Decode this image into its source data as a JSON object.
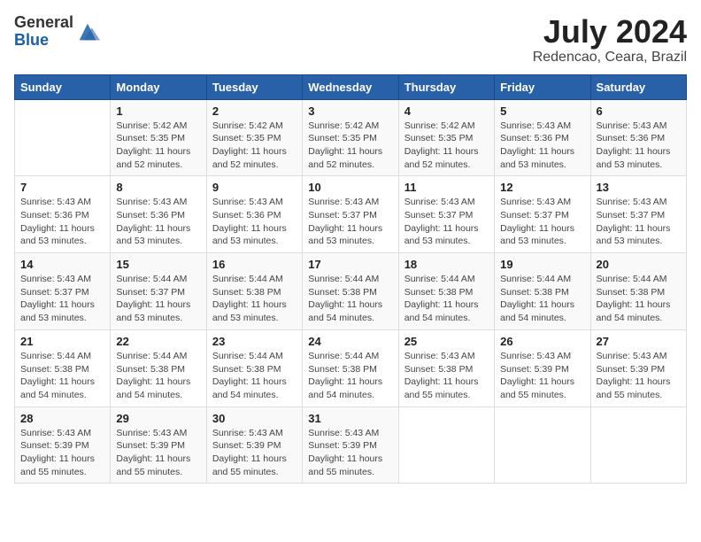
{
  "logo": {
    "general": "General",
    "blue": "Blue"
  },
  "title": "July 2024",
  "location": "Redencao, Ceara, Brazil",
  "days_of_week": [
    "Sunday",
    "Monday",
    "Tuesday",
    "Wednesday",
    "Thursday",
    "Friday",
    "Saturday"
  ],
  "weeks": [
    [
      {
        "num": "",
        "info": ""
      },
      {
        "num": "1",
        "info": "Sunrise: 5:42 AM\nSunset: 5:35 PM\nDaylight: 11 hours\nand 52 minutes."
      },
      {
        "num": "2",
        "info": "Sunrise: 5:42 AM\nSunset: 5:35 PM\nDaylight: 11 hours\nand 52 minutes."
      },
      {
        "num": "3",
        "info": "Sunrise: 5:42 AM\nSunset: 5:35 PM\nDaylight: 11 hours\nand 52 minutes."
      },
      {
        "num": "4",
        "info": "Sunrise: 5:42 AM\nSunset: 5:35 PM\nDaylight: 11 hours\nand 52 minutes."
      },
      {
        "num": "5",
        "info": "Sunrise: 5:43 AM\nSunset: 5:36 PM\nDaylight: 11 hours\nand 53 minutes."
      },
      {
        "num": "6",
        "info": "Sunrise: 5:43 AM\nSunset: 5:36 PM\nDaylight: 11 hours\nand 53 minutes."
      }
    ],
    [
      {
        "num": "7",
        "info": "Sunrise: 5:43 AM\nSunset: 5:36 PM\nDaylight: 11 hours\nand 53 minutes."
      },
      {
        "num": "8",
        "info": "Sunrise: 5:43 AM\nSunset: 5:36 PM\nDaylight: 11 hours\nand 53 minutes."
      },
      {
        "num": "9",
        "info": "Sunrise: 5:43 AM\nSunset: 5:36 PM\nDaylight: 11 hours\nand 53 minutes."
      },
      {
        "num": "10",
        "info": "Sunrise: 5:43 AM\nSunset: 5:37 PM\nDaylight: 11 hours\nand 53 minutes."
      },
      {
        "num": "11",
        "info": "Sunrise: 5:43 AM\nSunset: 5:37 PM\nDaylight: 11 hours\nand 53 minutes."
      },
      {
        "num": "12",
        "info": "Sunrise: 5:43 AM\nSunset: 5:37 PM\nDaylight: 11 hours\nand 53 minutes."
      },
      {
        "num": "13",
        "info": "Sunrise: 5:43 AM\nSunset: 5:37 PM\nDaylight: 11 hours\nand 53 minutes."
      }
    ],
    [
      {
        "num": "14",
        "info": "Sunrise: 5:43 AM\nSunset: 5:37 PM\nDaylight: 11 hours\nand 53 minutes."
      },
      {
        "num": "15",
        "info": "Sunrise: 5:44 AM\nSunset: 5:37 PM\nDaylight: 11 hours\nand 53 minutes."
      },
      {
        "num": "16",
        "info": "Sunrise: 5:44 AM\nSunset: 5:38 PM\nDaylight: 11 hours\nand 53 minutes."
      },
      {
        "num": "17",
        "info": "Sunrise: 5:44 AM\nSunset: 5:38 PM\nDaylight: 11 hours\nand 54 minutes."
      },
      {
        "num": "18",
        "info": "Sunrise: 5:44 AM\nSunset: 5:38 PM\nDaylight: 11 hours\nand 54 minutes."
      },
      {
        "num": "19",
        "info": "Sunrise: 5:44 AM\nSunset: 5:38 PM\nDaylight: 11 hours\nand 54 minutes."
      },
      {
        "num": "20",
        "info": "Sunrise: 5:44 AM\nSunset: 5:38 PM\nDaylight: 11 hours\nand 54 minutes."
      }
    ],
    [
      {
        "num": "21",
        "info": "Sunrise: 5:44 AM\nSunset: 5:38 PM\nDaylight: 11 hours\nand 54 minutes."
      },
      {
        "num": "22",
        "info": "Sunrise: 5:44 AM\nSunset: 5:38 PM\nDaylight: 11 hours\nand 54 minutes."
      },
      {
        "num": "23",
        "info": "Sunrise: 5:44 AM\nSunset: 5:38 PM\nDaylight: 11 hours\nand 54 minutes."
      },
      {
        "num": "24",
        "info": "Sunrise: 5:44 AM\nSunset: 5:38 PM\nDaylight: 11 hours\nand 54 minutes."
      },
      {
        "num": "25",
        "info": "Sunrise: 5:43 AM\nSunset: 5:38 PM\nDaylight: 11 hours\nand 55 minutes."
      },
      {
        "num": "26",
        "info": "Sunrise: 5:43 AM\nSunset: 5:39 PM\nDaylight: 11 hours\nand 55 minutes."
      },
      {
        "num": "27",
        "info": "Sunrise: 5:43 AM\nSunset: 5:39 PM\nDaylight: 11 hours\nand 55 minutes."
      }
    ],
    [
      {
        "num": "28",
        "info": "Sunrise: 5:43 AM\nSunset: 5:39 PM\nDaylight: 11 hours\nand 55 minutes."
      },
      {
        "num": "29",
        "info": "Sunrise: 5:43 AM\nSunset: 5:39 PM\nDaylight: 11 hours\nand 55 minutes."
      },
      {
        "num": "30",
        "info": "Sunrise: 5:43 AM\nSunset: 5:39 PM\nDaylight: 11 hours\nand 55 minutes."
      },
      {
        "num": "31",
        "info": "Sunrise: 5:43 AM\nSunset: 5:39 PM\nDaylight: 11 hours\nand 55 minutes."
      },
      {
        "num": "",
        "info": ""
      },
      {
        "num": "",
        "info": ""
      },
      {
        "num": "",
        "info": ""
      }
    ]
  ]
}
